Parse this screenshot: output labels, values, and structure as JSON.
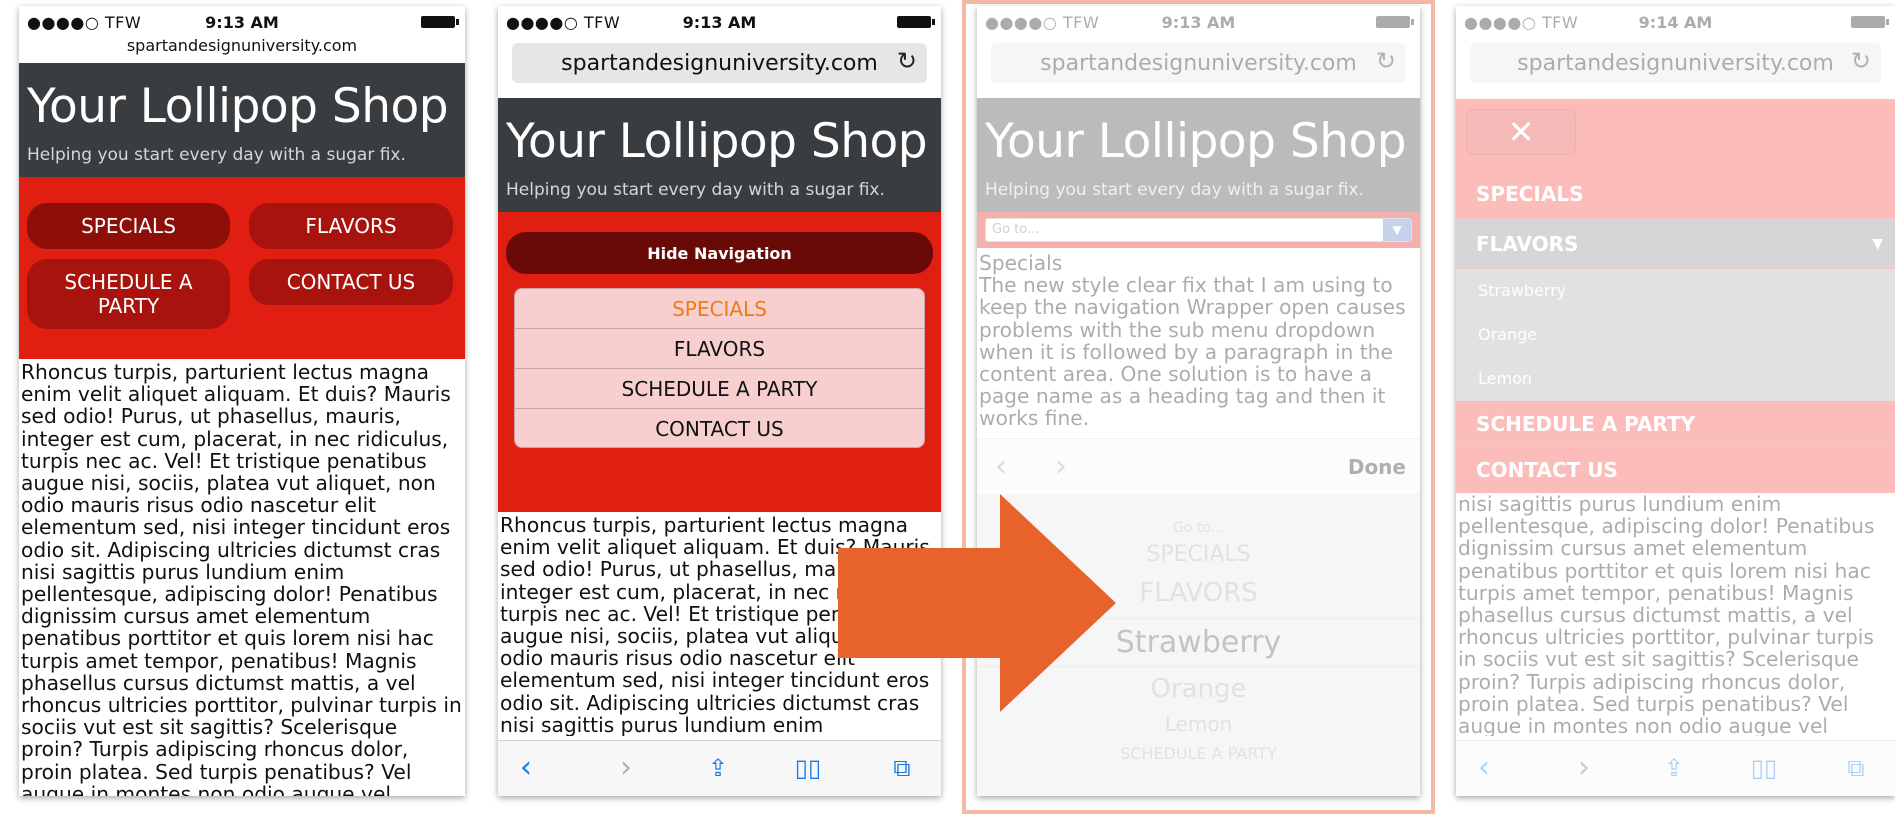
{
  "status": {
    "carrier": "●●●●○ TFW",
    "time_a": "9:13 AM",
    "time_b": "9:14 AM"
  },
  "site": {
    "url": "spartandesignuniversity.com",
    "title": "Your Lollipop Shop",
    "tagline": "Helping you start every day with a sugar fix."
  },
  "nav": {
    "specials": "SPECIALS",
    "flavors": "FLAVORS",
    "party": "SCHEDULE A PARTY",
    "party_line1": "SCHEDULE A",
    "party_line2": "PARTY",
    "contact": "CONTACT US",
    "hide": "Hide Navigation"
  },
  "body_text": "Rhoncus turpis, parturient lectus magna enim velit aliquet aliquam. Et duis? Mauris sed odio! Purus, ut phasellus, mauris, integer est cum, placerat, in nec ridiculus, turpis nec ac. Vel! Et tristique penatibus augue nisi, sociis, platea vut aliquet, non odio mauris risus odio nascetur elit elementum sed, nisi integer tincidunt eros odio sit. Adipiscing ultricies dictumst cras nisi sagittis purus lundium enim pellentesque, adipiscing dolor! Penatibus dignissim cursus amet elementum penatibus porttitor et quis lorem nisi hac turpis amet tempor, penatibus! Magnis phasellus cursus dictumst mattis, a vel rhoncus ultricies porttitor, pulvinar turpis in sociis vut est sit sagittis? Scelerisque proin? Turpis adipiscing rhoncus dolor, proin platea. Sed turpis penatibus? Vel augue in montes non odio augue vel montes.",
  "body_text_p4": "nisi sagittis purus lundium enim pellentesque, adipiscing dolor! Penatibus dignissim cursus amet elementum penatibus porttitor et quis lorem nisi hac turpis amet tempor, penatibus! Magnis phasellus cursus dictumst mattis, a vel rhoncus ultricies porttitor, pulvinar turpis in sociis vut est sit sagittis? Scelerisque proin? Turpis adipiscing rhoncus dolor, proin platea. Sed turpis penatibus? Vel augue in montes non odio augue vel montes.",
  "screen3": {
    "select_placeholder": "Go to...",
    "heading": "Specials",
    "note": "The new style clear fix that I am using to keep the navigation Wrapper open causes problems with the sub menu dropdown when it is followed by a paragraph in the content area. One solution is to have a page name as a heading tag and then it works fine.",
    "done": "Done",
    "picker": [
      "Go to...",
      "SPECIALS",
      "FLAVORS",
      "Strawberry",
      "Orange",
      "Lemon",
      "SCHEDULE A PARTY"
    ]
  },
  "screen4": {
    "close": "✕",
    "subs": [
      "Strawberry",
      "Orange",
      "Lemon"
    ]
  },
  "colors": {
    "accent_red": "#e01e12",
    "header_dark": "#3a3d40",
    "arrow_orange": "#e8622c",
    "ios_blue": "#1779e6"
  }
}
